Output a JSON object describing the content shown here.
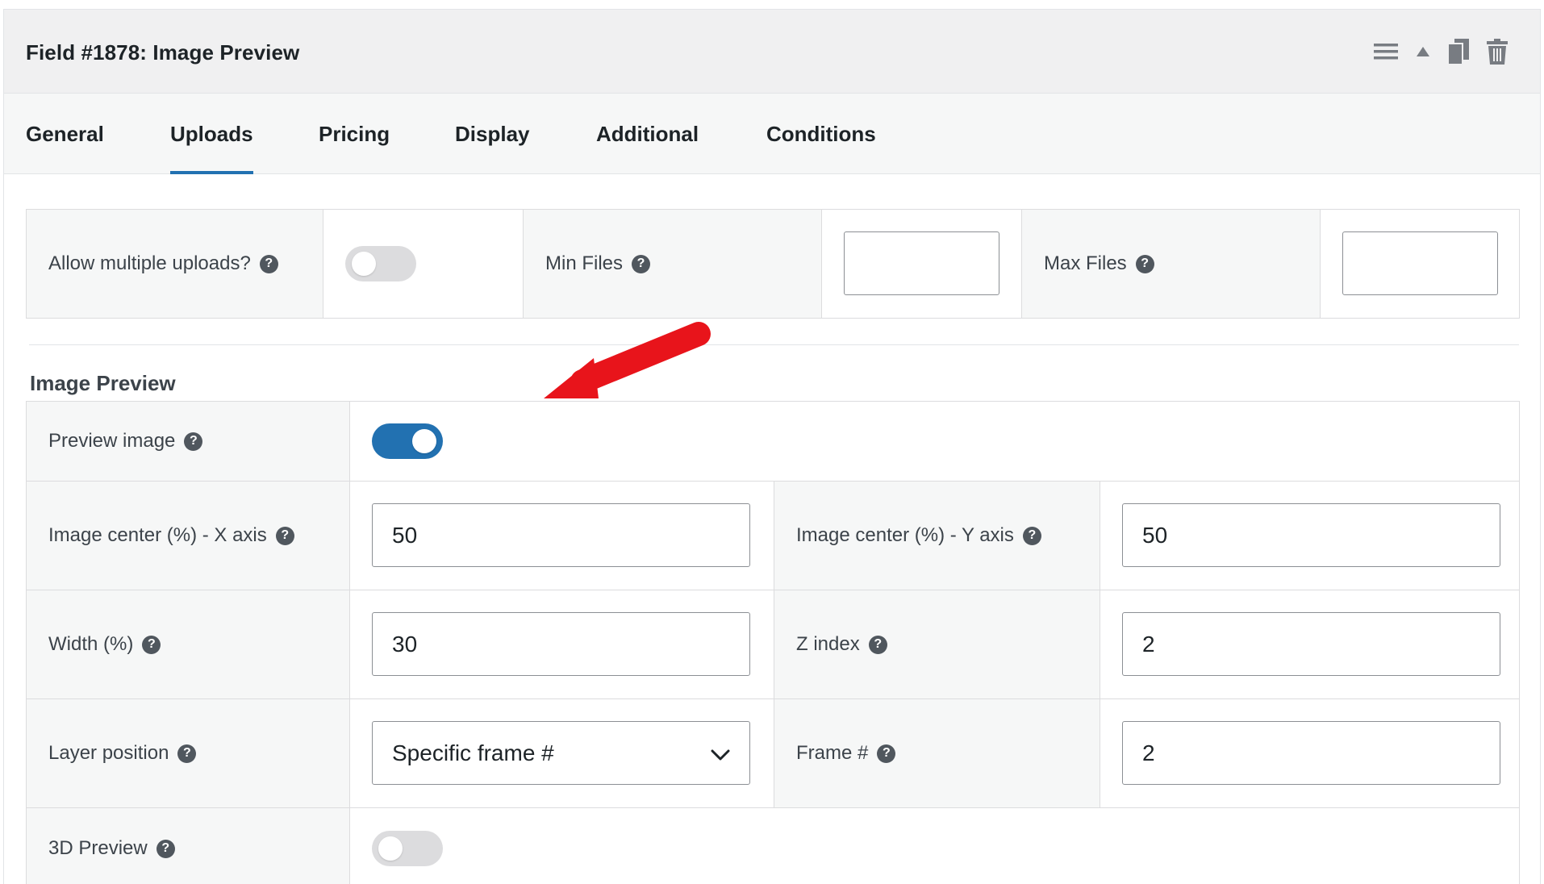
{
  "panel": {
    "title": "Field #1878: Image Preview",
    "icons": [
      "menu-icon",
      "collapse-arrow-icon",
      "duplicate-icon",
      "trash-icon"
    ]
  },
  "tabs": [
    {
      "label": "General",
      "active": false
    },
    {
      "label": "Uploads",
      "active": true
    },
    {
      "label": "Pricing",
      "active": false
    },
    {
      "label": "Display",
      "active": false
    },
    {
      "label": "Additional",
      "active": false
    },
    {
      "label": "Conditions",
      "active": false
    }
  ],
  "uploads": {
    "allow_multiple_label": "Allow multiple uploads?",
    "allow_multiple_on": false,
    "min_files_label": "Min Files",
    "min_files_value": "",
    "max_files_label": "Max Files",
    "max_files_value": ""
  },
  "image_preview": {
    "section_title": "Image Preview",
    "preview_image_label": "Preview image",
    "preview_image_on": true,
    "center_x_label": "Image center (%) - X axis",
    "center_x_value": "50",
    "center_y_label": "Image center (%) - Y axis",
    "center_y_value": "50",
    "width_label": "Width (%)",
    "width_value": "30",
    "z_index_label": "Z index",
    "z_index_value": "2",
    "layer_position_label": "Layer position",
    "layer_position_value": "Specific frame #",
    "frame_label": "Frame #",
    "frame_value": "2",
    "preview_3d_label": "3D Preview",
    "preview_3d_on": false
  },
  "help_glyph": "?",
  "colors": {
    "accent": "#2271b1",
    "arrow": "#e8141b",
    "toggle_off": "#dcdcde"
  }
}
